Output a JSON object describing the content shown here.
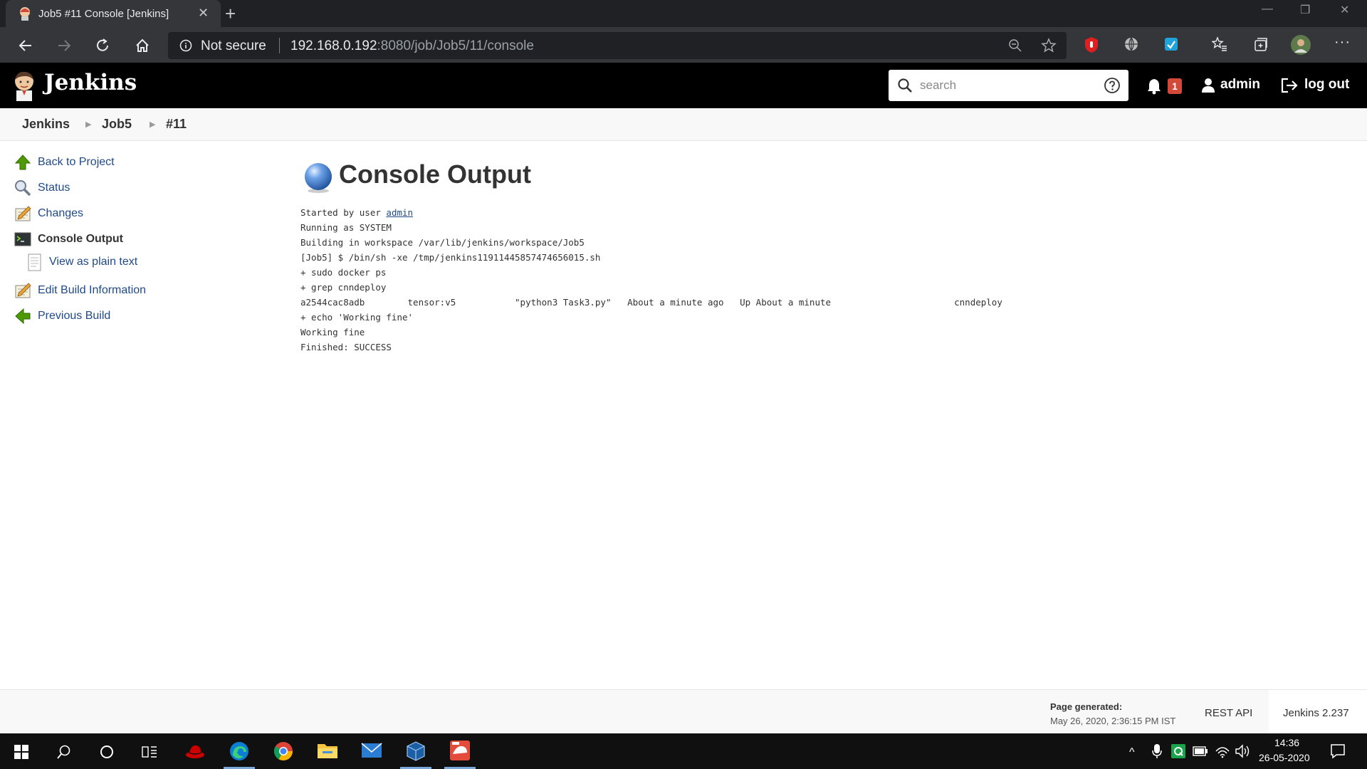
{
  "browser": {
    "tab_title": "Job5 #11 Console [Jenkins]",
    "security_label": "Not secure",
    "url_host": "192.168.0.192",
    "url_rest": ":8080/job/Job5/11/console"
  },
  "header": {
    "brand": "Jenkins",
    "search_placeholder": "search",
    "notification_count": "1",
    "user": "admin",
    "logout": "log out"
  },
  "breadcrumb": [
    "Jenkins",
    "Job5",
    "#11"
  ],
  "sidebar": {
    "items": [
      {
        "label": "Back to Project",
        "icon": "up-arrow-icon"
      },
      {
        "label": "Status",
        "icon": "magnifier-icon"
      },
      {
        "label": "Changes",
        "icon": "notepad-icon"
      },
      {
        "label": "Console Output",
        "icon": "terminal-icon"
      },
      {
        "label": "View as plain text",
        "icon": "document-icon"
      },
      {
        "label": "Edit Build Information",
        "icon": "notepad-icon"
      },
      {
        "label": "Previous Build",
        "icon": "left-arrow-icon"
      }
    ]
  },
  "main": {
    "title": "Console Output",
    "console": {
      "started_prefix": "Started by user ",
      "started_user": "admin",
      "lines": [
        "Running as SYSTEM",
        "Building in workspace /var/lib/jenkins/workspace/Job5",
        "[Job5] $ /bin/sh -xe /tmp/jenkins11911445857474656015.sh",
        "+ sudo docker ps",
        "+ grep cnndeploy",
        "a2544cac8adb        tensor:v5           \"python3 Task3.py\"   About a minute ago   Up About a minute                       cnndeploy",
        "+ echo 'Working fine'",
        "Working fine",
        "Finished: SUCCESS"
      ]
    }
  },
  "footer": {
    "page_generated_label": "Page generated:",
    "page_generated_date": "May 26, 2020, 2:36:15 PM IST",
    "rest_api": "REST API",
    "version": "Jenkins 2.237"
  },
  "taskbar": {
    "time": "14:36",
    "date": "26-05-2020"
  },
  "colors": {
    "jenkins_header": "#000000",
    "link": "#204a87",
    "badge": "#d24939"
  }
}
